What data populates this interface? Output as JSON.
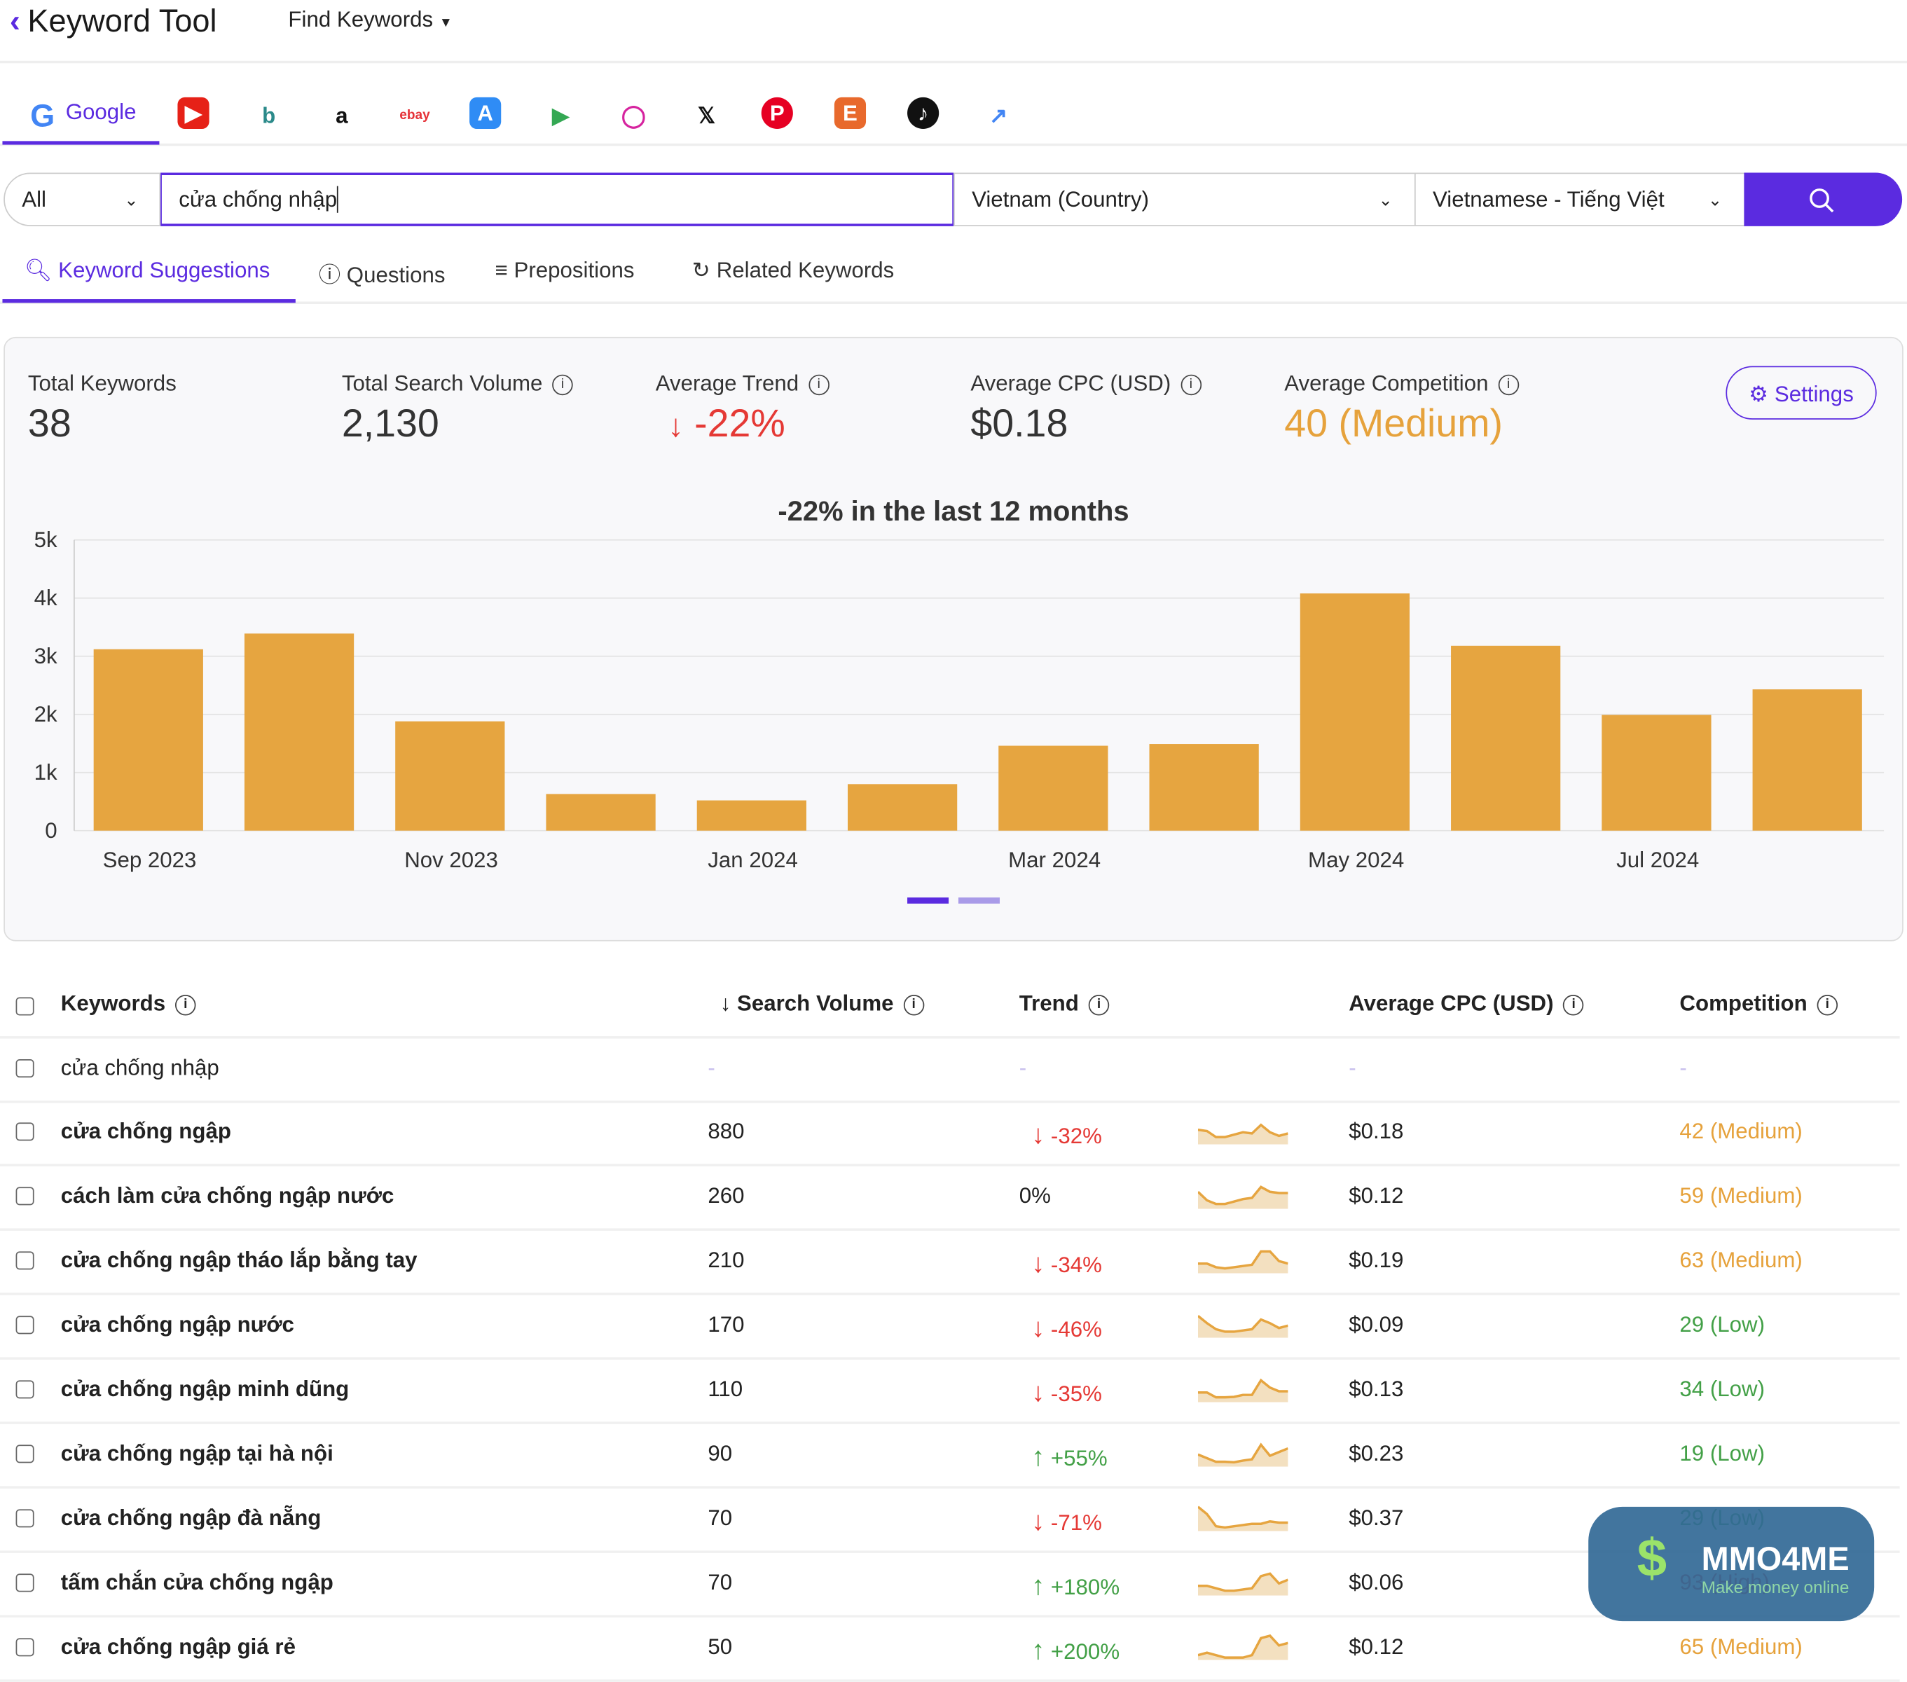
{
  "app": {
    "title": "Keyword Tool",
    "nav_menu": "Find Keywords"
  },
  "platforms": [
    {
      "label": "Google",
      "icon": "google-icon"
    },
    {
      "icon": "youtube-icon"
    },
    {
      "icon": "bing-icon"
    },
    {
      "icon": "amazon-icon"
    },
    {
      "icon": "ebay-icon"
    },
    {
      "icon": "app-store-icon"
    },
    {
      "icon": "play-store-icon"
    },
    {
      "icon": "instagram-icon"
    },
    {
      "icon": "x-icon"
    },
    {
      "icon": "pinterest-icon"
    },
    {
      "icon": "etsy-icon"
    },
    {
      "icon": "tiktok-icon"
    },
    {
      "icon": "trends-icon"
    }
  ],
  "search": {
    "type": "All",
    "query": "cửa chống nhập",
    "country": "Vietnam (Country)",
    "language": "Vietnamese - Tiếng Việt"
  },
  "tabs": [
    "Keyword Suggestions",
    "Questions",
    "Prepositions",
    "Related Keywords"
  ],
  "stats": {
    "total_keywords_label": "Total Keywords",
    "total_keywords": "38",
    "total_volume_label": "Total Search Volume",
    "total_volume": "2,130",
    "avg_trend_label": "Average Trend",
    "avg_trend": "-22%",
    "avg_cpc_label": "Average CPC (USD)",
    "avg_cpc": "$0.18",
    "avg_comp_label": "Average Competition",
    "avg_comp": "40 (Medium)",
    "settings": "Settings"
  },
  "colors": {
    "accent": "#5b2be0",
    "bar": "#e6a540",
    "down": "#e53935",
    "up": "#43a047",
    "medium": "#e6a23c"
  },
  "chart_data": {
    "type": "bar",
    "title": "-22% in the last 12 months",
    "categories": [
      "Sep 2023",
      "Oct 2023",
      "Nov 2023",
      "Dec 2023",
      "Jan 2024",
      "Feb 2024",
      "Mar 2024",
      "Apr 2024",
      "May 2024",
      "Jun 2024",
      "Jul 2024",
      "Aug 2024"
    ],
    "tick_labels": [
      "Sep 2023",
      "Nov 2023",
      "Jan 2024",
      "Mar 2024",
      "May 2024",
      "Jul 2024"
    ],
    "values": [
      3120,
      3390,
      1880,
      630,
      520,
      800,
      1460,
      1490,
      4080,
      3180,
      1990,
      2430
    ],
    "ylim": [
      0,
      5000
    ],
    "yticks": [
      "0",
      "1k",
      "2k",
      "3k",
      "4k",
      "5k"
    ],
    "grid": true
  },
  "table": {
    "headers": {
      "keywords": "Keywords",
      "volume": "Search Volume",
      "trend": "Trend",
      "cpc": "Average CPC (USD)",
      "competition": "Competition"
    },
    "rows": [
      {
        "kw": "cửa chống nhập",
        "vol": "-",
        "trend": "-",
        "dir": "none",
        "cpc": "-",
        "comp": "-",
        "level": "none",
        "bold": false,
        "spark": []
      },
      {
        "kw": "cửa chống ngập",
        "vol": "880",
        "trend": "-32%",
        "dir": "down",
        "cpc": "$0.18",
        "comp": "42 (Medium)",
        "level": "med",
        "spark": [
          5,
          4.5,
          2,
          2,
          3,
          4,
          3.5,
          7,
          4,
          2.5,
          3.5
        ]
      },
      {
        "kw": "cách làm cửa chống ngập nước",
        "vol": "260",
        "trend": "0%",
        "dir": "none",
        "cpc": "$0.12",
        "comp": "59 (Medium)",
        "level": "med",
        "spark": [
          6,
          2.5,
          1,
          1,
          2,
          3,
          3.5,
          8,
          6,
          5.5,
          5.5
        ]
      },
      {
        "kw": "cửa chống ngập tháo lắp bằng tay",
        "vol": "210",
        "trend": "-34%",
        "dir": "down",
        "cpc": "$0.19",
        "comp": "63 (Medium)",
        "level": "med",
        "spark": [
          3,
          3,
          1.5,
          1,
          1.5,
          2,
          2.5,
          8,
          8,
          4,
          3
        ]
      },
      {
        "kw": "cửa chống ngập nước",
        "vol": "170",
        "trend": "-46%",
        "dir": "down",
        "cpc": "$0.09",
        "comp": "29 (Low)",
        "level": "low",
        "spark": [
          8,
          5,
          2.5,
          1.5,
          1.5,
          2,
          2.5,
          6.5,
          5,
          3,
          4
        ]
      },
      {
        "kw": "cửa chống ngập minh dũng",
        "vol": "110",
        "trend": "-35%",
        "dir": "down",
        "cpc": "$0.13",
        "comp": "34 (Low)",
        "level": "low",
        "spark": [
          3,
          3,
          1,
          1,
          1.2,
          2,
          2,
          8,
          5,
          3.5,
          3.5
        ]
      },
      {
        "kw": "cửa chống ngập tại hà nội",
        "vol": "90",
        "trend": "+55%",
        "dir": "up",
        "cpc": "$0.23",
        "comp": "19 (Low)",
        "level": "low",
        "spark": [
          4,
          2.5,
          1,
          1,
          0.8,
          1.5,
          2,
          8,
          3.5,
          5,
          6.5
        ]
      },
      {
        "kw": "cửa chống ngập đà nẵng",
        "vol": "70",
        "trend": "-71%",
        "dir": "down",
        "cpc": "$0.37",
        "comp": "29 (Low)",
        "level": "low",
        "spark": [
          9,
          6,
          1,
          0.5,
          1,
          1.5,
          2,
          2,
          3,
          2.5,
          2.5
        ]
      },
      {
        "kw": "tấm chắn cửa chống ngập",
        "vol": "70",
        "trend": "+180%",
        "dir": "up",
        "cpc": "$0.06",
        "comp": "93 (High)",
        "level": "high",
        "spark": [
          3,
          3,
          2,
          1,
          1,
          1.5,
          2,
          7,
          8,
          4,
          5.5
        ]
      },
      {
        "kw": "cửa chống ngập giá rẻ",
        "vol": "50",
        "trend": "+200%",
        "dir": "up",
        "cpc": "$0.12",
        "comp": "65 (Medium)",
        "level": "med",
        "spark": [
          1,
          2,
          1,
          0,
          0,
          0,
          1,
          8,
          9,
          5,
          6
        ]
      }
    ]
  },
  "watermark": {
    "brand": "MMO4ME",
    "tagline": "Make money online"
  }
}
